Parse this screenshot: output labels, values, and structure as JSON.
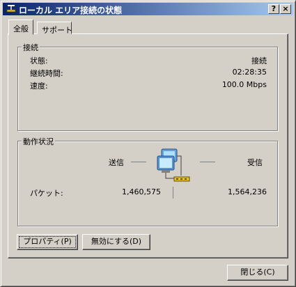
{
  "window": {
    "title": "ローカル エリア接続の状態",
    "help_label": "?",
    "close_label": "×"
  },
  "tabs": [
    {
      "label": "全般",
      "active": true
    },
    {
      "label": "サポート",
      "active": false
    }
  ],
  "connection": {
    "legend": "接続",
    "rows": [
      {
        "label": "状態:",
        "value": "接続"
      },
      {
        "label": "継続時間:",
        "value": "02:28:35"
      },
      {
        "label": "速度:",
        "value": "100.0 Mbps"
      }
    ]
  },
  "activity": {
    "legend": "動作状況",
    "sent_label": "送信",
    "received_label": "受信",
    "packets_label": "パケット:",
    "packets_sent": "1,460,575",
    "packets_received": "1,564,236"
  },
  "buttons": {
    "properties": "プロパティ(P)",
    "disable": "無効にする(D)",
    "close": "閉じる(C)"
  }
}
